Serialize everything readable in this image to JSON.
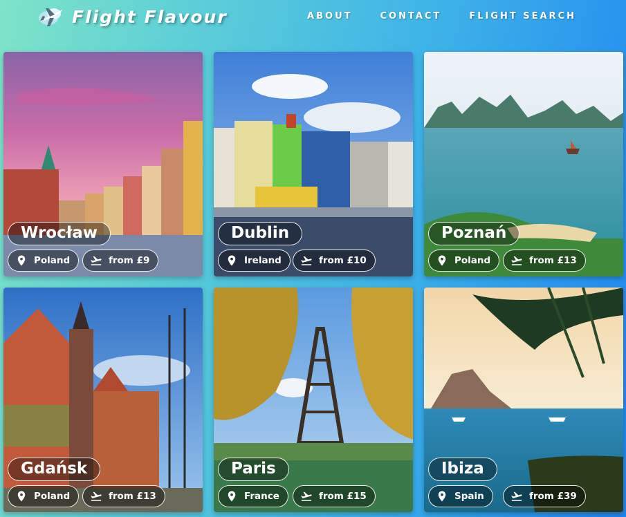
{
  "brand": {
    "name": "Flight Flavour",
    "logo_icon": "plane-icon"
  },
  "nav": {
    "items": [
      "ABOUT",
      "CONTACT",
      "FLIGHT SEARCH"
    ]
  },
  "cards": [
    {
      "city": "Wrocław",
      "country": "Poland",
      "price": "from £9"
    },
    {
      "city": "Dublin",
      "country": "Ireland",
      "price": "from £10"
    },
    {
      "city": "Poznań",
      "country": "Poland",
      "price": "from £13"
    },
    {
      "city": "Gdańsk",
      "country": "Poland",
      "price": "from £13"
    },
    {
      "city": "Paris",
      "country": "France",
      "price": "from £15"
    },
    {
      "city": "Ibiza",
      "country": "Spain",
      "price": "from £39"
    }
  ],
  "colors": {
    "bg_start": "#7fe3c8",
    "bg_end": "#1f86f0",
    "text": "#ffffff"
  }
}
